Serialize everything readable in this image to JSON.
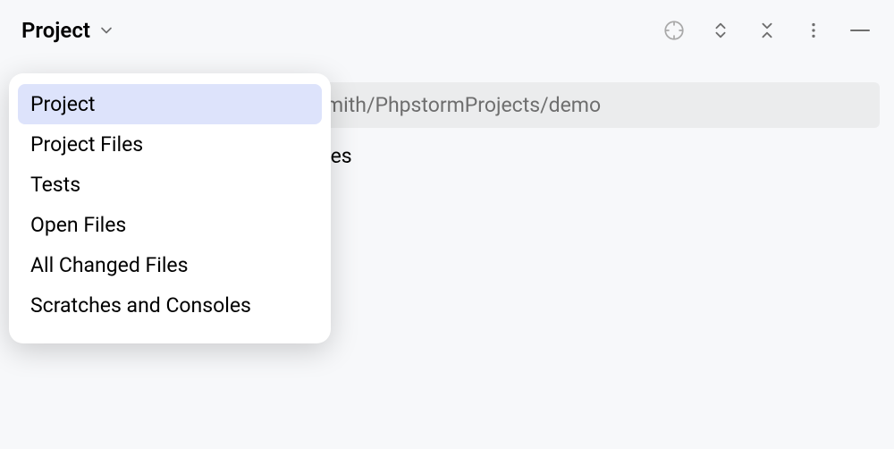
{
  "toolbar": {
    "view_selector_label": "Project"
  },
  "content": {
    "path_text": "mith/PhpstormProjects/demo",
    "secondary_text": "les"
  },
  "dropdown": {
    "items": [
      {
        "label": "Project",
        "selected": true
      },
      {
        "label": "Project Files",
        "selected": false
      },
      {
        "label": "Tests",
        "selected": false
      },
      {
        "label": "Open Files",
        "selected": false
      },
      {
        "label": "All Changed Files",
        "selected": false
      },
      {
        "label": "Scratches and Consoles",
        "selected": false
      }
    ]
  }
}
